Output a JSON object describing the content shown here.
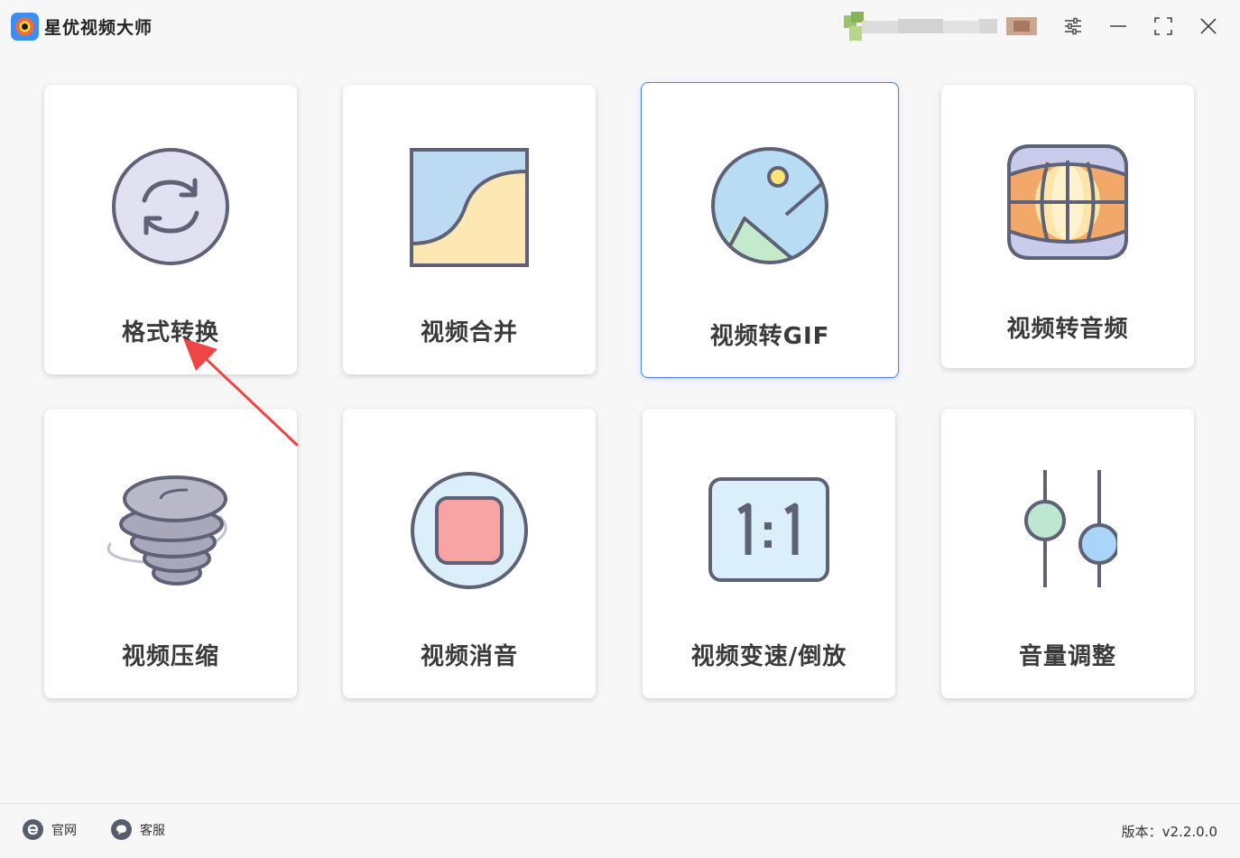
{
  "app": {
    "title": "星优视频大师"
  },
  "tools": [
    {
      "label": "格式转换",
      "icon": "format-convert-icon"
    },
    {
      "label": "视频合并",
      "icon": "video-merge-icon"
    },
    {
      "label": "视频转GIF",
      "icon": "image-gif-icon",
      "selected": true
    },
    {
      "label": "视频转音频",
      "icon": "globe-audio-icon"
    },
    {
      "label": "视频压缩",
      "icon": "tornado-compress-icon"
    },
    {
      "label": "视频消音",
      "icon": "stop-mute-icon"
    },
    {
      "label": "视频变速/倒放",
      "icon": "ratio-speed-icon"
    },
    {
      "label": "音量调整",
      "icon": "slider-volume-icon"
    }
  ],
  "footer": {
    "website_label": "官网",
    "support_label": "客服",
    "version_text": "版本：v2.2.0.0"
  },
  "colors": {
    "accent": "#4a7cf5",
    "icon_stroke": "#5f6177",
    "annotation_arrow": "#ee4545"
  }
}
